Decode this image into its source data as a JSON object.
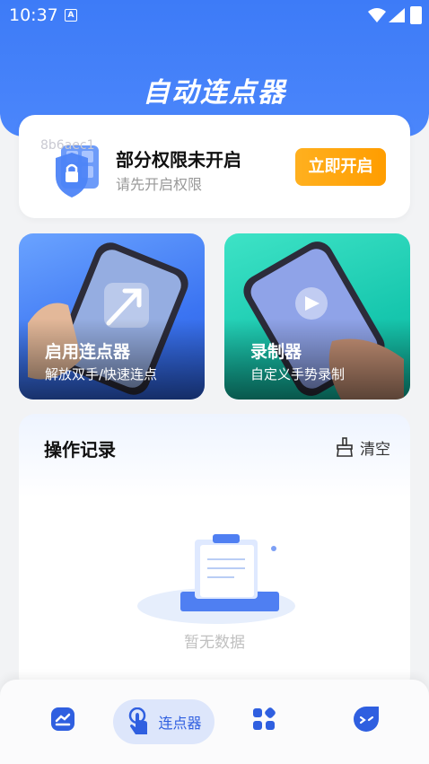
{
  "status_bar": {
    "time": "10:37",
    "notif_icon": "a-icon"
  },
  "app": {
    "title": "自动连点器"
  },
  "permission": {
    "title": "部分权限未开启",
    "subtitle": "请先开启权限",
    "button": "立即开启",
    "overlay_text": "8b6aec1"
  },
  "features": [
    {
      "title": "启用连点器",
      "subtitle": "解放双手/快速连点"
    },
    {
      "title": "录制器",
      "subtitle": "自定义手势录制"
    }
  ],
  "records": {
    "title": "操作记录",
    "clear": "清空",
    "empty": "暂无数据"
  },
  "nav": {
    "active_label": "连点器"
  },
  "colors": {
    "primary": "#3d7bf7",
    "accent": "#ff9d00",
    "teal": "#17c7ae"
  }
}
